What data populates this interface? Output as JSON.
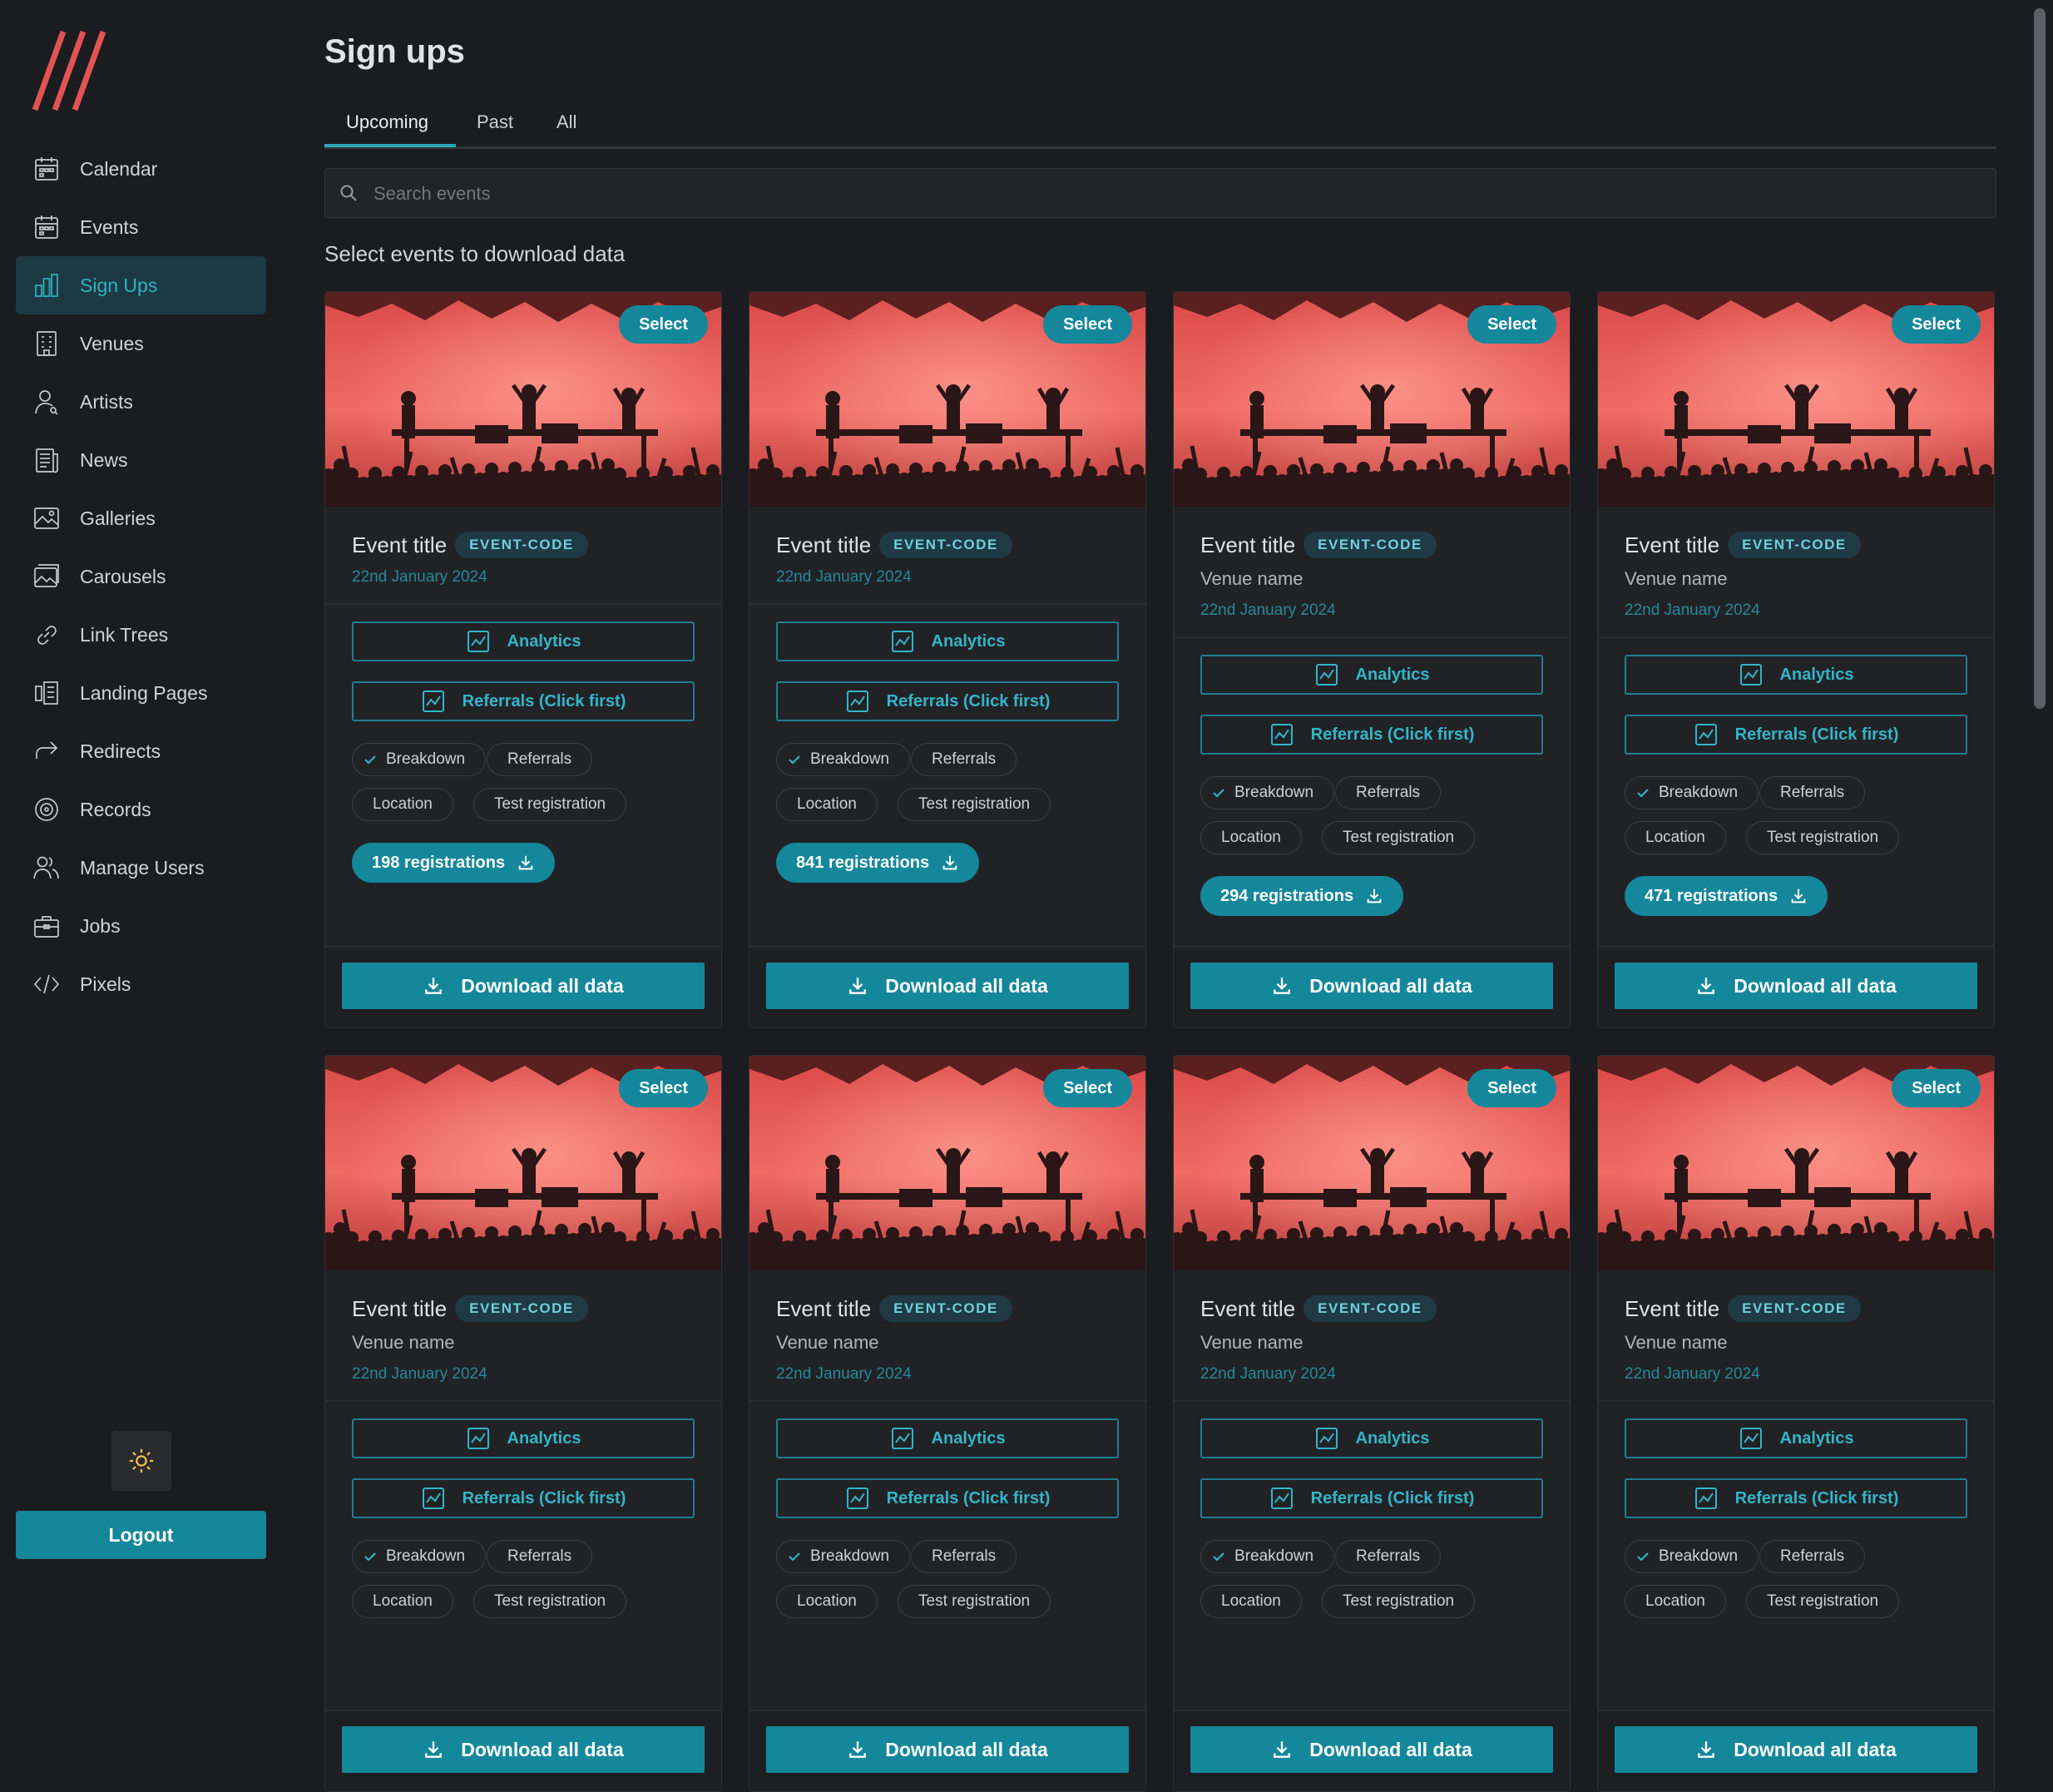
{
  "sidebar": {
    "items": [
      {
        "label": "Calendar",
        "icon": "calendar-icon"
      },
      {
        "label": "Events",
        "icon": "calendar-icon"
      },
      {
        "label": "Sign Ups",
        "icon": "bar-chart-icon",
        "active": true
      },
      {
        "label": "Venues",
        "icon": "building-icon"
      },
      {
        "label": "Artists",
        "icon": "user-icon"
      },
      {
        "label": "News",
        "icon": "newspaper-icon"
      },
      {
        "label": "Galleries",
        "icon": "image-icon"
      },
      {
        "label": "Carousels",
        "icon": "images-icon"
      },
      {
        "label": "Link Trees",
        "icon": "link-icon"
      },
      {
        "label": "Landing Pages",
        "icon": "layout-icon"
      },
      {
        "label": "Redirects",
        "icon": "redirect-icon"
      },
      {
        "label": "Records",
        "icon": "record-icon"
      },
      {
        "label": "Manage Users",
        "icon": "users-icon"
      },
      {
        "label": "Jobs",
        "icon": "briefcase-icon"
      },
      {
        "label": "Pixels",
        "icon": "code-icon"
      }
    ],
    "logout_label": "Logout"
  },
  "header": {
    "title": "Sign ups",
    "tabs": [
      {
        "label": "Upcoming",
        "active": true
      },
      {
        "label": "Past"
      },
      {
        "label": "All"
      }
    ]
  },
  "search": {
    "placeholder": "Search events"
  },
  "subtitle": "Select events to download data",
  "colors": {
    "accent": "#14879b",
    "accent_text": "#31b6c8",
    "background": "#1b1c1f",
    "card": "#212226",
    "hero": "#e05555"
  },
  "card_labels": {
    "select": "Select",
    "analytics": "Analytics",
    "referrals": "Referrals (Click first)",
    "download_all": "Download all data",
    "chips": [
      "Breakdown",
      "Referrals",
      "Location",
      "Test registration"
    ]
  },
  "cards": [
    {
      "title": "Event title",
      "code": "EVENT-CODE",
      "venue": "",
      "date": "22nd January 2024",
      "registrations": "198 registrations"
    },
    {
      "title": "Event title",
      "code": "EVENT-CODE",
      "venue": "",
      "date": "22nd January 2024",
      "registrations": "841 registrations"
    },
    {
      "title": "Event title",
      "code": "EVENT-CODE",
      "venue": "Venue name",
      "date": "22nd January 2024",
      "registrations": "294 registrations"
    },
    {
      "title": "Event title",
      "code": "EVENT-CODE",
      "venue": "Venue name",
      "date": "22nd January 2024",
      "registrations": "471 registrations"
    },
    {
      "title": "Event title",
      "code": "EVENT-CODE",
      "venue": "Venue name",
      "date": "22nd January 2024",
      "registrations": ""
    },
    {
      "title": "Event title",
      "code": "EVENT-CODE",
      "venue": "Venue name",
      "date": "22nd January 2024",
      "registrations": ""
    },
    {
      "title": "Event title",
      "code": "EVENT-CODE",
      "venue": "Venue name",
      "date": "22nd January 2024",
      "registrations": ""
    },
    {
      "title": "Event title",
      "code": "EVENT-CODE",
      "venue": "Venue name",
      "date": "22nd January 2024",
      "registrations": ""
    }
  ]
}
